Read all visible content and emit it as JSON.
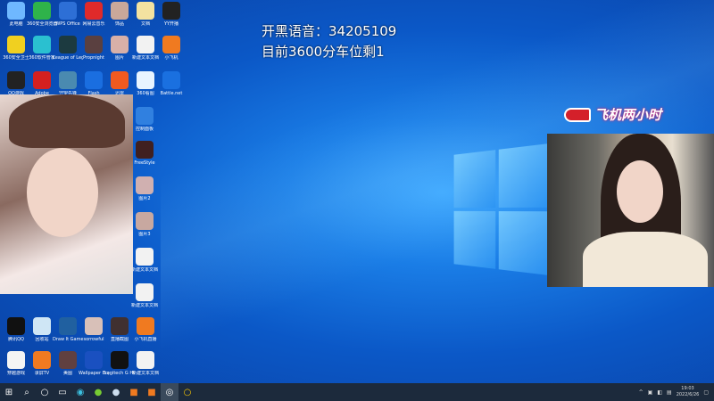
{
  "overlay": {
    "line1": "开黑语音：34205109",
    "line2": "目前3600分车位剩1",
    "banner": "飞机两小时"
  },
  "desktop_icons": [
    {
      "label": "此电脑",
      "color": "#6fb8ff"
    },
    {
      "label": "360安全浏览器",
      "color": "#2fb34a"
    },
    {
      "label": "WPS Office",
      "color": "#2d6fd6"
    },
    {
      "label": "网易云音乐",
      "color": "#e02a2a"
    },
    {
      "label": "饰品",
      "color": "#c9a89a"
    },
    {
      "label": "文档",
      "color": "#f3e2a0"
    },
    {
      "label": "YY开播",
      "color": "#222"
    },
    {
      "label": "360安全卫士",
      "color": "#f0d020"
    },
    {
      "label": "360软件管家",
      "color": "#2ac0d0"
    },
    {
      "label": "League of Legends",
      "color": "#1c3a40"
    },
    {
      "label": "Propnight",
      "color": "#5a4040"
    },
    {
      "label": "图片",
      "color": "#d8b0a8"
    },
    {
      "label": "新建文本文档",
      "color": "#f2f2f2"
    },
    {
      "label": "小飞机",
      "color": "#f07a20"
    },
    {
      "label": "QQ游戏",
      "color": "#222"
    },
    {
      "label": "Adobe",
      "color": "#d42020"
    },
    {
      "label": "守望先锋",
      "color": "#4a8ab0"
    },
    {
      "label": "Flash",
      "color": "#1a6ee0"
    },
    {
      "label": "迅雷",
      "color": "#f05a20"
    },
    {
      "label": "360看图",
      "color": "#e8f4ff"
    },
    {
      "label": "Battle.net",
      "color": "#1a70e0"
    },
    {
      "label": "控制面板",
      "color": "#3080e0"
    },
    {
      "label": "FreeStyle",
      "color": "#402020"
    },
    {
      "label": "图片2",
      "color": "#d0b0b0"
    },
    {
      "label": "图片3",
      "color": "#c8a8a0"
    },
    {
      "label": "新建文本文档",
      "color": "#f2f2f2"
    },
    {
      "label": "新建文本文档",
      "color": "#f2f2f2"
    },
    {
      "label": "腾讯QQ",
      "color": "#111"
    },
    {
      "label": "回收站",
      "color": "#cfe6f5"
    },
    {
      "label": "Draw It Game",
      "color": "#2060a0"
    },
    {
      "label": "sorrowful",
      "color": "#d8c0b8"
    },
    {
      "label": "直播截图",
      "color": "#403030"
    },
    {
      "label": "小飞机直播",
      "color": "#f07a20"
    },
    {
      "label": "穿越游戏",
      "color": "#f4f4f4"
    },
    {
      "label": "录屏TV",
      "color": "#f07a20"
    },
    {
      "label": "美图",
      "color": "#604040"
    },
    {
      "label": "Wallpaper Engine",
      "color": "#1a50c0"
    },
    {
      "label": "Logitech G HUB",
      "color": "#111"
    },
    {
      "label": "新建文本文档",
      "color": "#f2f2f2"
    }
  ],
  "taskbar": {
    "start": "start",
    "search": "search",
    "time": "19:03",
    "date": "2022/6/26"
  }
}
